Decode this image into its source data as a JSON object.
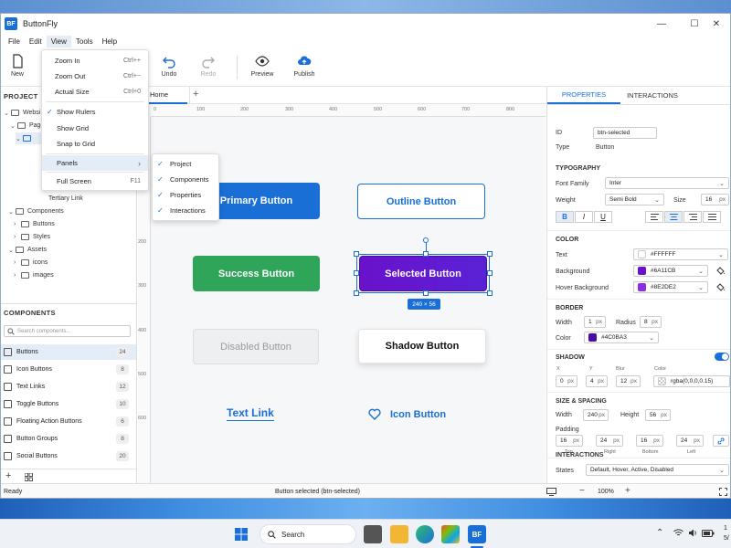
{
  "app": {
    "logo": "BF",
    "title": "ButtonFly"
  },
  "window_controls": {
    "minimize": "—",
    "maximize": "☐",
    "close": "✕"
  },
  "menubar": [
    "File",
    "Edit",
    "View",
    "Tools",
    "Help"
  ],
  "toolbar": {
    "new": "New",
    "undo": "Undo",
    "redo": "Redo",
    "preview": "Preview",
    "publish": "Publish"
  },
  "view_menu": {
    "items": [
      {
        "label": "Zoom In",
        "shortcut": "Ctrl++"
      },
      {
        "label": "Zoom Out",
        "shortcut": "Ctrl+−"
      },
      {
        "label": "Actual Size",
        "shortcut": "Ctrl+0"
      },
      {
        "label": "Show Rulers",
        "check": "✓"
      },
      {
        "label": "Show Grid"
      },
      {
        "label": "Snap to Grid"
      },
      {
        "label": "Panels",
        "arrow": "›"
      },
      {
        "label": "Full Screen",
        "shortcut": "F11"
      }
    ]
  },
  "panels_submenu": [
    "Project",
    "Components",
    "Properties",
    "Interactions"
  ],
  "panels_check": "✓",
  "project": {
    "header": "PROJECT",
    "tree": [
      "Websi",
      "Page",
      "Tertiary Link",
      "Components",
      "Buttons",
      "Styles",
      "Assets",
      "icons",
      "images"
    ]
  },
  "components": {
    "header": "COMPONENTS",
    "search_placeholder": "Search components...",
    "items": [
      {
        "label": "Buttons",
        "count": "24"
      },
      {
        "label": "Icon Buttons",
        "count": "8"
      },
      {
        "label": "Text Links",
        "count": "12"
      },
      {
        "label": "Toggle Buttons",
        "count": "10"
      },
      {
        "label": "Floating Action Buttons",
        "count": "6"
      },
      {
        "label": "Button Groups",
        "count": "8"
      },
      {
        "label": "Social Buttons",
        "count": "20"
      }
    ],
    "add": "+"
  },
  "doc_tab": {
    "label": "Home",
    "add": "+"
  },
  "ruler": {
    "h": [
      "0",
      "100",
      "200",
      "300",
      "400",
      "500",
      "600",
      "700",
      "800"
    ],
    "v": [
      "200",
      "300",
      "400",
      "500",
      "600"
    ]
  },
  "canvas": {
    "primary": "Primary Button",
    "outline": "Outline Button",
    "success": "Success Button",
    "selected": "Selected Button",
    "disabled": "Disabled Button",
    "shadow": "Shadow Button",
    "text_link": "Text Link",
    "icon_button": "Icon Button",
    "size_badge": "240 × 56"
  },
  "colors": {
    "primary": "#1A6FD6",
    "success": "#2FA55A",
    "selected": "#6A11CB",
    "selected_hover": "#8E2DE2",
    "border": "#4C0BA3",
    "accent": "#1A6FD6"
  },
  "properties": {
    "tabs": [
      "PROPERTIES",
      "INTERACTIONS"
    ],
    "id_label": "ID",
    "id_value": "btn-selected",
    "type_label": "Type",
    "type_value": "Button",
    "typography": "TYPOGRAPHY",
    "font_family_label": "Font Family",
    "font_family": "Inter",
    "weight_label": "Weight",
    "weight": "Semi Bold",
    "size_label": "Size",
    "size": "16",
    "px": "px",
    "bold": "B",
    "italic": "I",
    "underline": "U",
    "color_section": "COLOR",
    "text_label": "Text",
    "text_color": "#FFFFFF",
    "bg_label": "Background",
    "bg_color": "#6A11CB",
    "hover_label": "Hover Background",
    "hover_color": "#8E2DE2",
    "border_section": "BORDER",
    "width_label": "Width",
    "border_width": "1",
    "radius_label": "Radius",
    "radius": "8",
    "border_color_label": "Color",
    "border_color": "#4C0BA3",
    "shadow_section": "SHADOW",
    "sx_label": "X",
    "sy_label": "Y",
    "blur_label": "Blur",
    "scolor_label": "Color",
    "sx": "0",
    "sy": "4",
    "blur": "12",
    "shadow_color": "rgba(0,0,0,0.15)",
    "size_section": "SIZE & SPACING",
    "w_label": "Width",
    "w": "240",
    "h_label": "Height",
    "h": "56",
    "padding_label": "Padding",
    "pad": [
      {
        "value": "16",
        "label": "Top"
      },
      {
        "value": "24",
        "label": "Right"
      },
      {
        "value": "16",
        "label": "Bottom"
      },
      {
        "value": "24",
        "label": "Left"
      }
    ],
    "interactions_section": "INTERACTIONS",
    "states_label": "States",
    "states": "Default, Hover, Active, Disabled"
  },
  "status": {
    "left": "Ready",
    "center": "Button selected (btn-selected)",
    "zoom": "100%",
    "minus": "−",
    "plus": "+"
  },
  "taskbar": {
    "search": "Search",
    "app": "BF",
    "clock_top": "1",
    "clock_bottom": "5/"
  }
}
